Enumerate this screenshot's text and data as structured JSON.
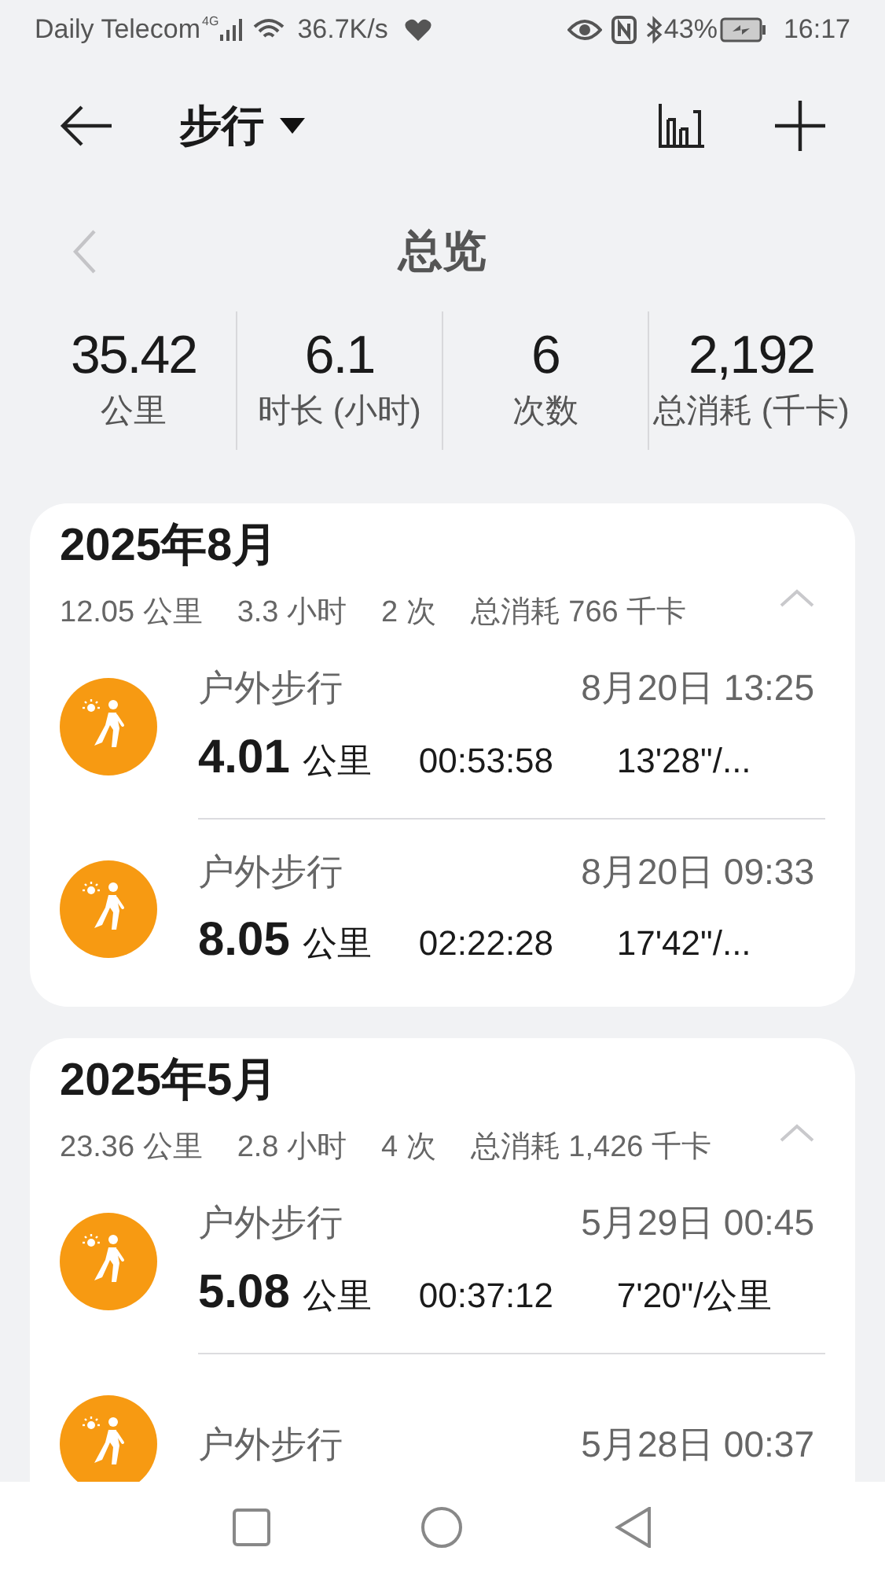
{
  "status_bar": {
    "carrier": "Daily Telecom",
    "network": "4G",
    "speed": "36.7K/s",
    "battery": "43%",
    "time": "16:17"
  },
  "header": {
    "title": "步行"
  },
  "overview": {
    "title": "总览",
    "stats": [
      {
        "value": "35.42",
        "label": "公里"
      },
      {
        "value": "6.1",
        "label": "时长 (小时)"
      },
      {
        "value": "6",
        "label": "次数"
      },
      {
        "value": "2,192",
        "label": "总消耗 (千卡)"
      }
    ]
  },
  "months": [
    {
      "title": "2025年8月",
      "expanded": true,
      "summary": [
        "12.05 公里",
        "3.3 小时",
        "2 次",
        "总消耗 766 千卡"
      ],
      "records": [
        {
          "name": "户外步行",
          "time": "8月20日 13:25",
          "distance": "4.01",
          "unit": "公里",
          "duration": "00:53:58",
          "pace": "13'28\"/..."
        },
        {
          "name": "户外步行",
          "time": "8月20日 09:33",
          "distance": "8.05",
          "unit": "公里",
          "duration": "02:22:28",
          "pace": "17'42\"/..."
        }
      ]
    },
    {
      "title": "2025年5月",
      "expanded": true,
      "summary": [
        "23.36 公里",
        "2.8 小时",
        "4 次",
        "总消耗 1,426 千卡"
      ],
      "records": [
        {
          "name": "户外步行",
          "time": "5月29日 00:45",
          "distance": "5.08",
          "unit": "公里",
          "duration": "00:37:12",
          "pace": "7'20\"/公里"
        },
        {
          "name": "户外步行",
          "time": "5月28日 00:37"
        }
      ]
    }
  ]
}
